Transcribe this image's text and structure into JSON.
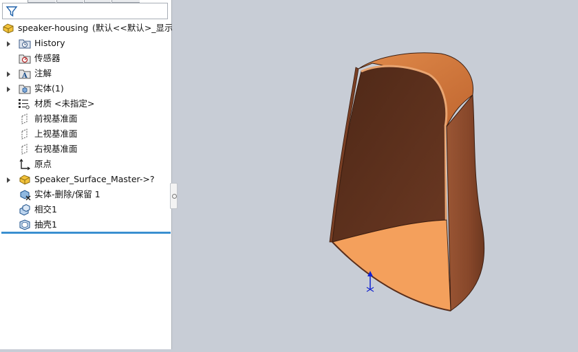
{
  "tree": {
    "root": {
      "name": "speaker-housing",
      "config": "(默认<<默认>_显示状"
    },
    "items": [
      {
        "label": "History",
        "expandable": true,
        "icon": "history-folder-icon"
      },
      {
        "label": "传感器",
        "expandable": false,
        "icon": "sensor-icon"
      },
      {
        "label": "注解",
        "expandable": true,
        "icon": "annotation-icon"
      },
      {
        "label": "实体(1)",
        "expandable": true,
        "icon": "solid-bodies-icon"
      },
      {
        "label": "材质 <未指定>",
        "expandable": false,
        "icon": "material-icon"
      },
      {
        "label": "前视基准面",
        "expandable": false,
        "icon": "plane-icon"
      },
      {
        "label": "上视基准面",
        "expandable": false,
        "icon": "plane-icon"
      },
      {
        "label": "右视基准面",
        "expandable": false,
        "icon": "plane-icon"
      },
      {
        "label": "原点",
        "expandable": false,
        "icon": "origin-icon"
      },
      {
        "label": "Speaker_Surface_Master->?",
        "expandable": true,
        "icon": "part-reference-icon"
      },
      {
        "label": "实体-删除/保留 1",
        "expandable": false,
        "icon": "body-delete-icon"
      },
      {
        "label": "相交1",
        "expandable": false,
        "icon": "intersect-icon"
      },
      {
        "label": "抽壳1",
        "expandable": false,
        "icon": "shell-icon"
      }
    ]
  },
  "colors": {
    "viewport_bg": "#c8cdd6",
    "rollback_bar": "#3a8fd0",
    "model_outer": "#8a4a2c",
    "model_inner": "#5a2f1c",
    "model_cut_face": "#f4a05c",
    "model_rim": "#e49a66"
  }
}
